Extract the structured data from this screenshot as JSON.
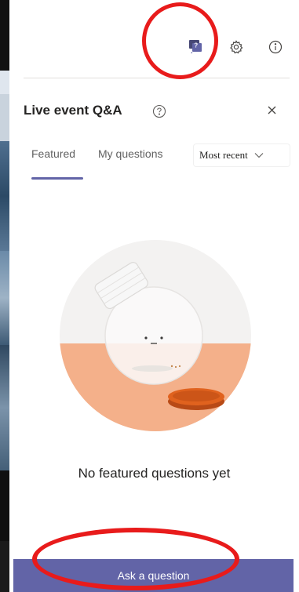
{
  "panel": {
    "title": "Live event Q&A",
    "empty_message": "No featured questions yet",
    "ask_button_label": "Ask a question"
  },
  "toolbar": {
    "icons": [
      "qa-icon",
      "gear-icon",
      "info-icon"
    ]
  },
  "tabs": [
    {
      "label": "Featured",
      "selected": true
    },
    {
      "label": "My questions",
      "selected": false
    }
  ],
  "sort": {
    "selected": "Most recent"
  },
  "colors": {
    "accent": "#6264a7",
    "annotation": "#e81b1b",
    "illustration_base": "#f4b08a",
    "lid": "#e0621e"
  }
}
